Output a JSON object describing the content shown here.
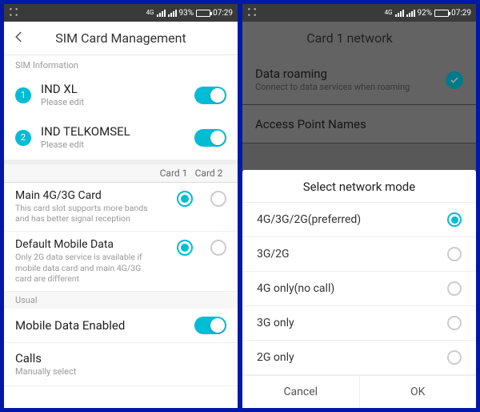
{
  "left": {
    "status": {
      "battery": "93%",
      "time": "07:29",
      "net": "4G"
    },
    "title": "SIM Card Management",
    "section_label": "SIM Information",
    "sims": [
      {
        "badge": "1",
        "name": "IND XL",
        "sub": "Please edit"
      },
      {
        "badge": "2",
        "name": "IND TELKOMSEL",
        "sub": "Please edit"
      }
    ],
    "cols": {
      "c1": "Card 1",
      "c2": "Card 2"
    },
    "main4g": {
      "title": "Main 4G/3G Card",
      "sub": "This card slot supports more bands and has better signal reception"
    },
    "defdata": {
      "title": "Default Mobile Data",
      "sub": "Only 2G data service is available if mobile data card and main 4G/3G card are different"
    },
    "usual": "Usual",
    "mde": {
      "title": "Mobile Data Enabled"
    },
    "calls": {
      "title": "Calls",
      "sub": "Manually select"
    }
  },
  "right": {
    "status": {
      "battery": "92%",
      "time": "07:29",
      "net": "4G"
    },
    "title": "Card 1 network",
    "roaming": {
      "title": "Data roaming",
      "sub": "Connect to data services when roaming"
    },
    "apn": {
      "title": "Access Point Names"
    },
    "sheet_title": "Select network mode",
    "options": [
      {
        "label": "4G/3G/2G(preferred)",
        "selected": true
      },
      {
        "label": "3G/2G",
        "selected": false
      },
      {
        "label": "4G only(no call)",
        "selected": false
      },
      {
        "label": "3G only",
        "selected": false
      },
      {
        "label": "2G only",
        "selected": false
      }
    ],
    "cancel": "Cancel",
    "ok": "OK"
  }
}
